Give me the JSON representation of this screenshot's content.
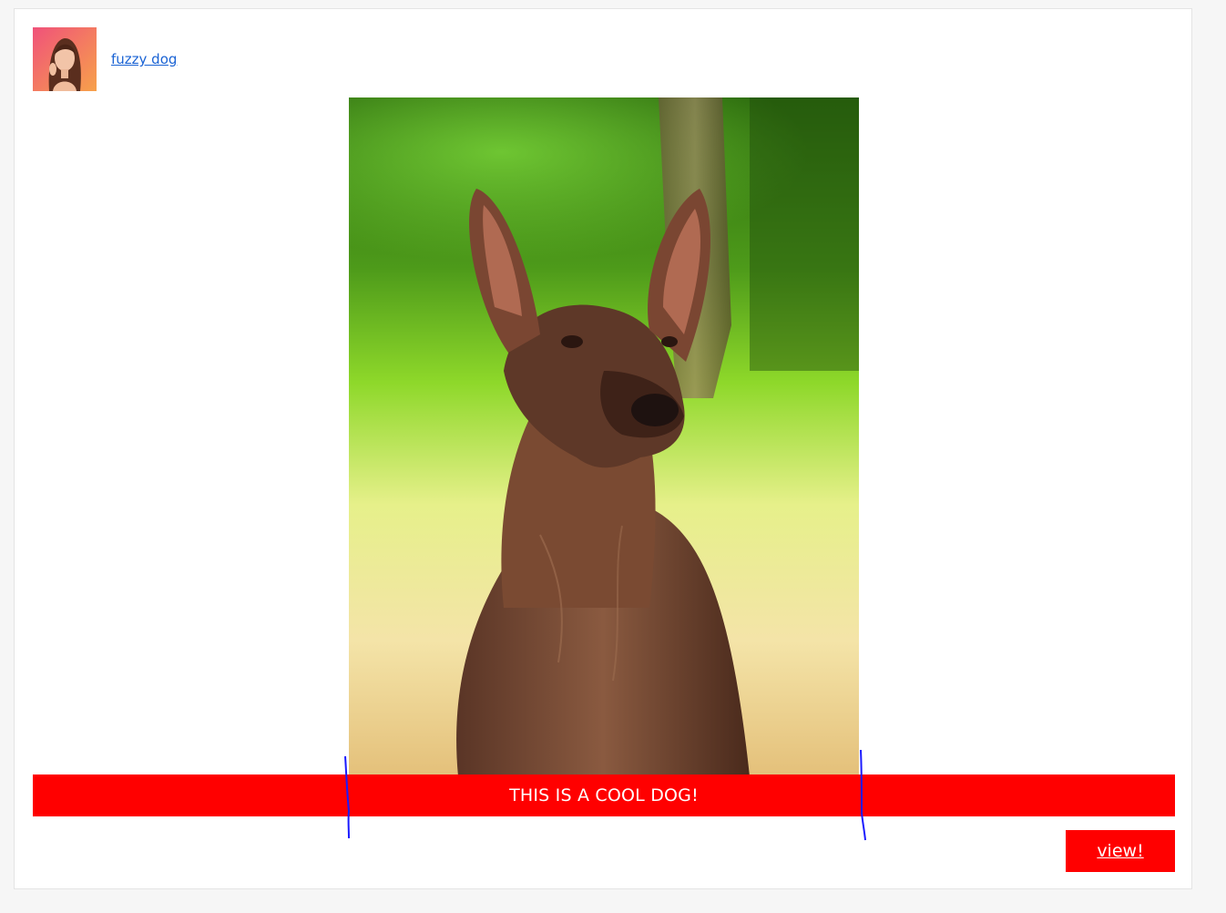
{
  "post": {
    "author_name": "fuzzy dog",
    "avatar_icon": "user-avatar-photo",
    "image_icon": "dog-photo",
    "caption": "THIS IS A COOL DOG!",
    "view_label": "view!"
  },
  "colors": {
    "accent": "#ff0000",
    "link": "#1a63d4",
    "annotation": "#1a1aff"
  }
}
